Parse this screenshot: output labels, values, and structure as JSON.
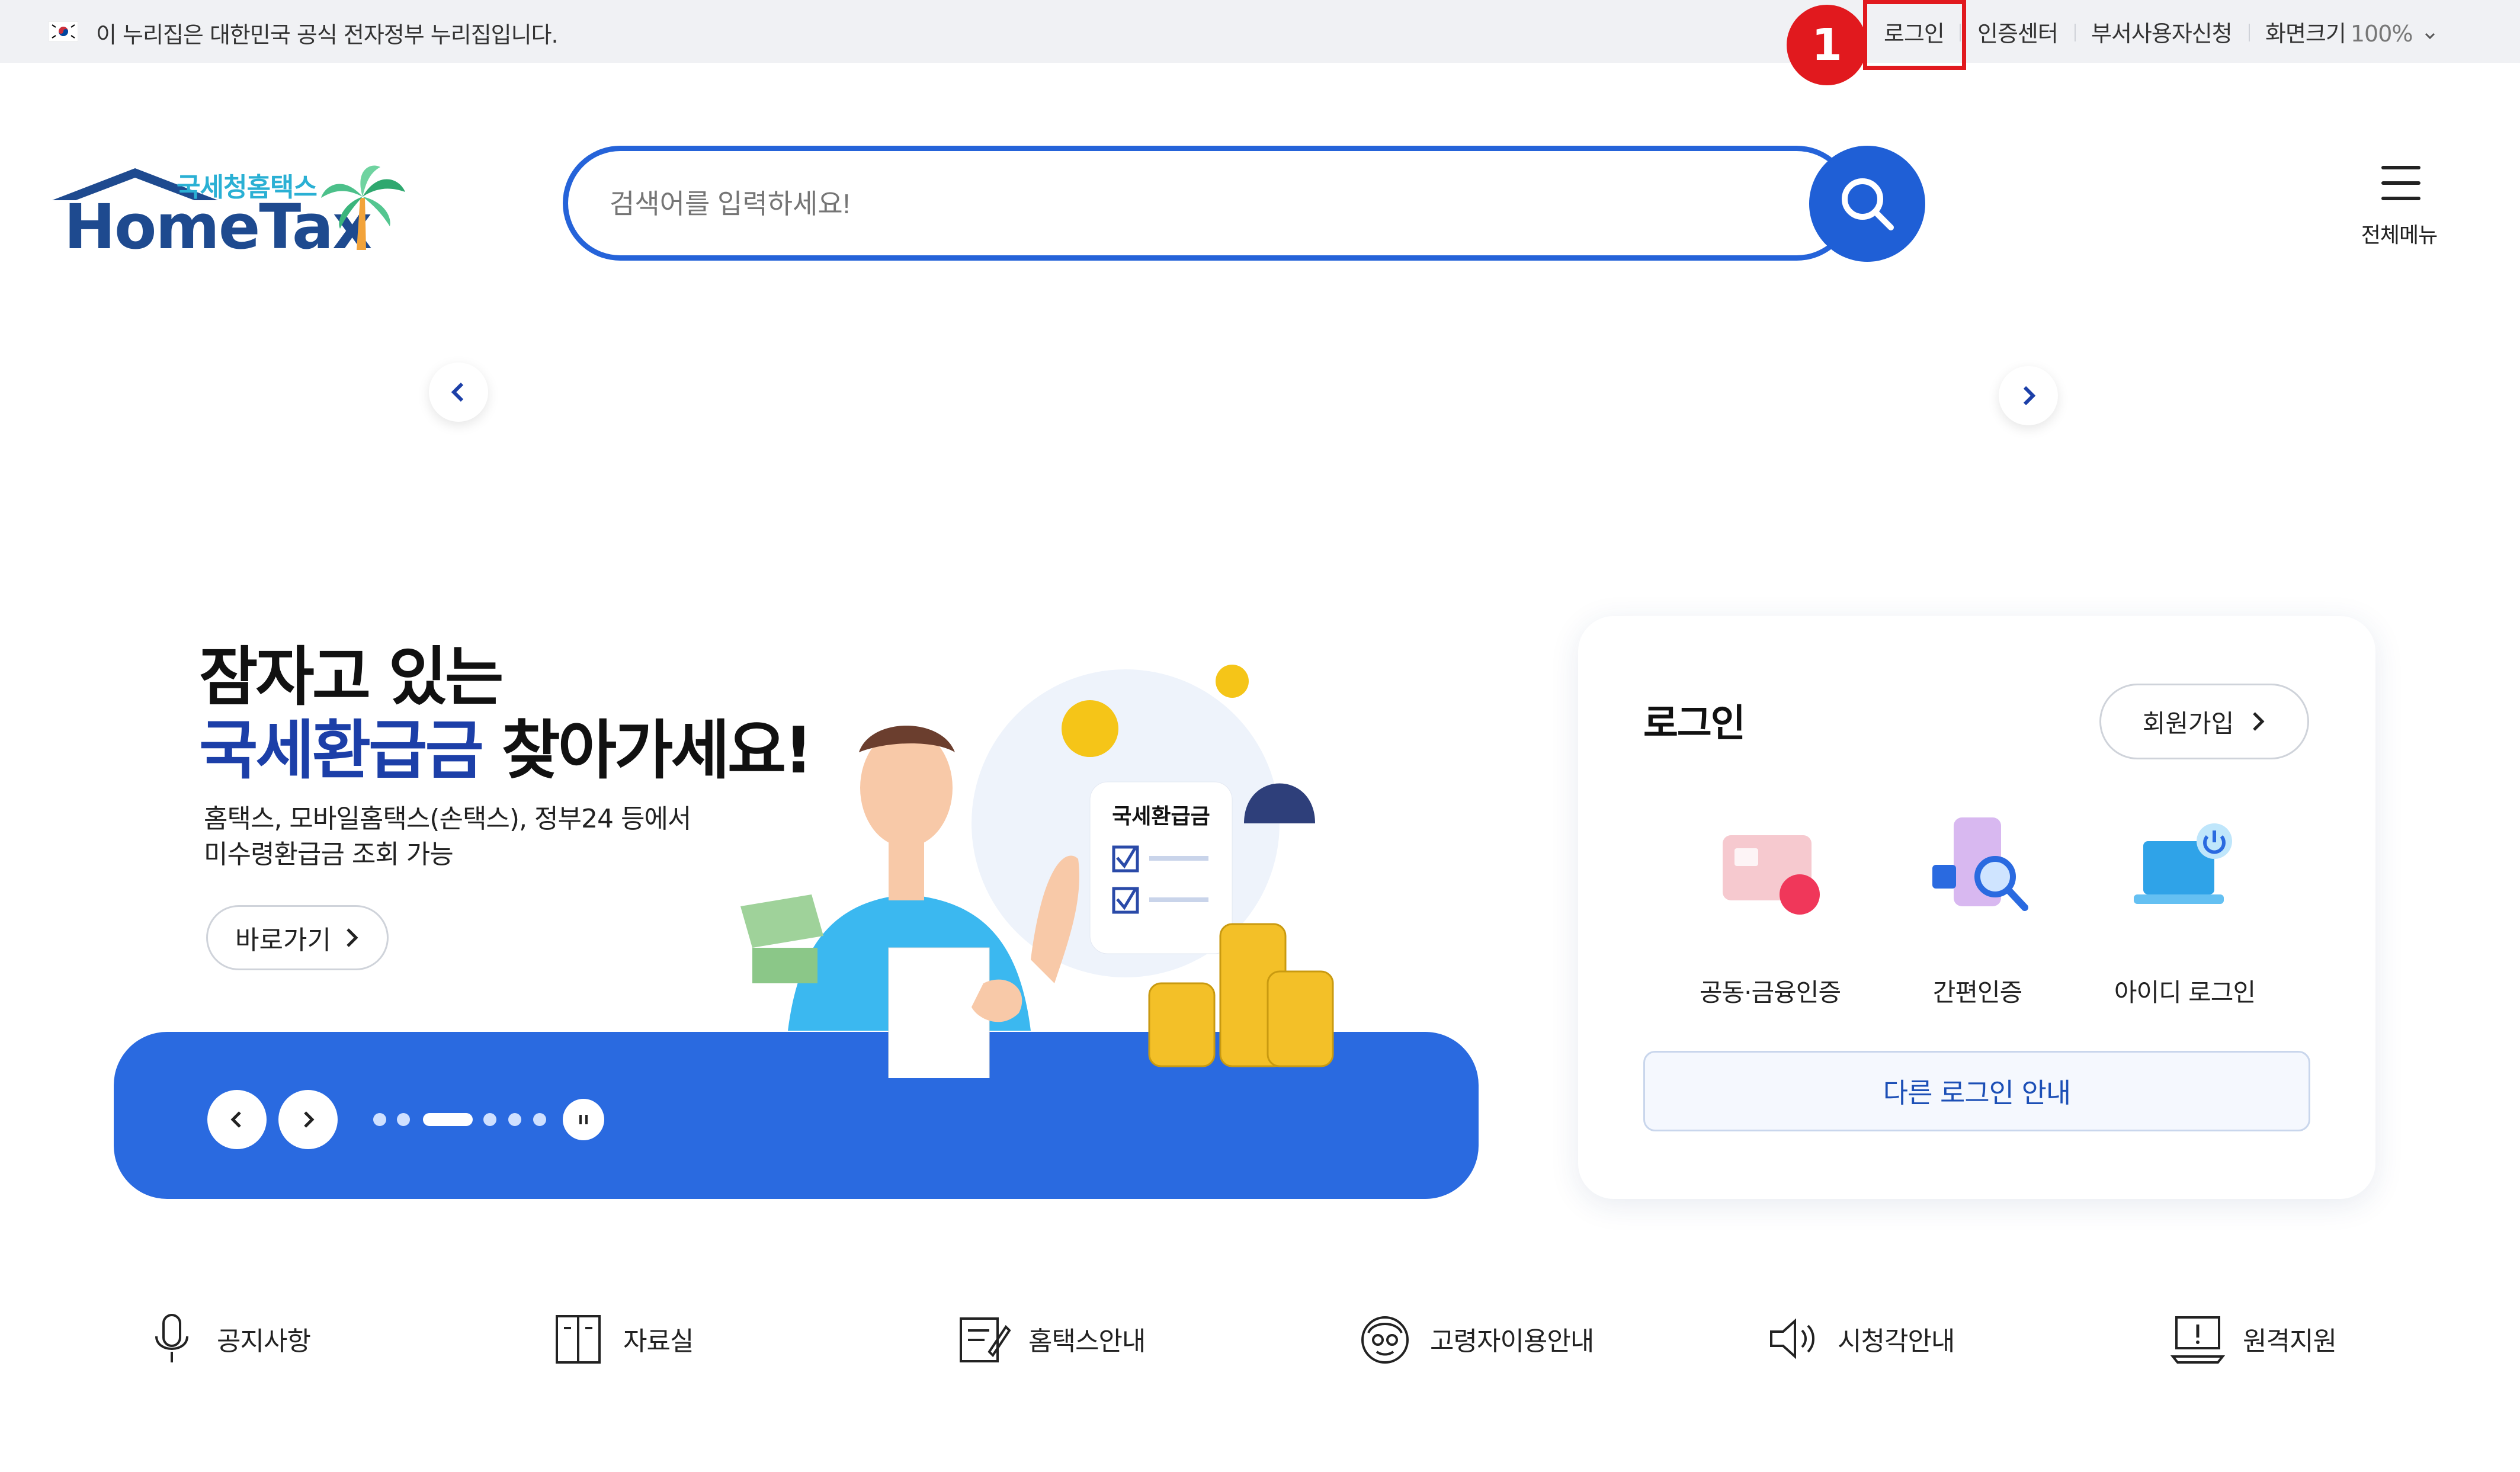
{
  "gov_bar": {
    "notice": "이 누리집은 대한민국 공식 전자정부 누리집입니다.",
    "login": "로그인",
    "cert_center": "인증센터",
    "dept_user_apply": "부서사용자신청",
    "screen_size_label": "화면크기",
    "screen_size_value": "100%"
  },
  "annotation": {
    "step": "1",
    "color": "#e1191e"
  },
  "logo": {
    "sub": "국세청홈택스",
    "main": "HomeTax"
  },
  "search": {
    "placeholder": "검색어를 입력하세요!"
  },
  "menu": {
    "label": "전체메뉴"
  },
  "banner": {
    "line1": "잠자고 있는",
    "line2_highlight": "국세환급금",
    "line2_rest": " 찾아가세요!",
    "desc1": "홈택스, 모바일홈택스(손택스), 정부24 등에서",
    "desc2": "미수령환급금 조회 가능",
    "go_button": "바로가기",
    "card_label": "국세환급금",
    "slide_count": 6,
    "active_slide": 3
  },
  "login_card": {
    "title": "로그인",
    "join": "회원가입",
    "options": [
      {
        "label": "공동·금융인증",
        "icon": "certificate-card-icon"
      },
      {
        "label": "간편인증",
        "icon": "phone-search-icon"
      },
      {
        "label": "아이디 로그인",
        "icon": "laptop-power-icon"
      }
    ],
    "other": "다른 로그인 안내"
  },
  "quick_menu": [
    {
      "label": "공지사항",
      "icon": "microphone-icon"
    },
    {
      "label": "자료실",
      "icon": "archive-icon"
    },
    {
      "label": "홈택스안내",
      "icon": "edit-document-icon"
    },
    {
      "label": "고령자이용안내",
      "icon": "senior-icon"
    },
    {
      "label": "시청각안내",
      "icon": "speaker-icon"
    },
    {
      "label": "원격지원",
      "icon": "remote-support-icon"
    }
  ],
  "colors": {
    "brand_blue": "#2563d9",
    "banner_blue": "#2a6ae0",
    "navy": "#1c3fa8"
  }
}
